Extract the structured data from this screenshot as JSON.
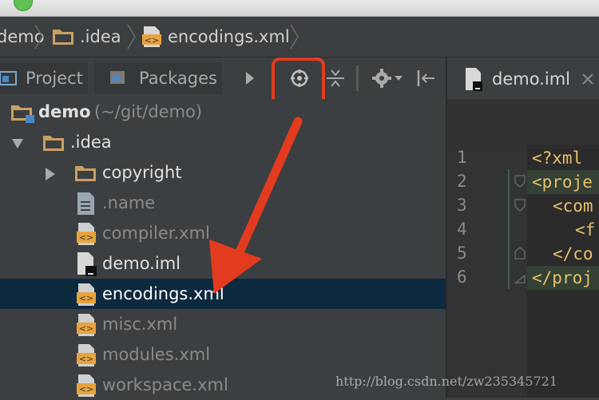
{
  "breadcrumbs": [
    "demo",
    ".idea",
    "encodings.xml"
  ],
  "tool_window": {
    "tabs": [
      {
        "label": "Project"
      },
      {
        "label": "Packages"
      }
    ]
  },
  "editor": {
    "tab_label": "demo.iml",
    "line_numbers": [
      "1",
      "2",
      "3",
      "4",
      "5",
      "6"
    ],
    "lines": [
      "<?xml",
      "<proje",
      "<com",
      "<f",
      "</co",
      "</proj"
    ]
  },
  "tree": {
    "root_label": "demo",
    "root_path": "(~/git/demo)",
    "items": [
      {
        "label": ".idea"
      },
      {
        "label": "copyright"
      },
      {
        "label": ".name"
      },
      {
        "label": "compiler.xml"
      },
      {
        "label": "demo.iml"
      },
      {
        "label": "encodings.xml"
      },
      {
        "label": "misc.xml"
      },
      {
        "label": "modules.xml"
      },
      {
        "label": "workspace.xml"
      }
    ]
  },
  "watermark": "http://blog.csdn.net/zw235345721",
  "colors": {
    "accent_highlight": "#e33b1f",
    "selection": "#0d293e",
    "folder": "#c9a062",
    "xml_icon": "#e8a33d"
  }
}
